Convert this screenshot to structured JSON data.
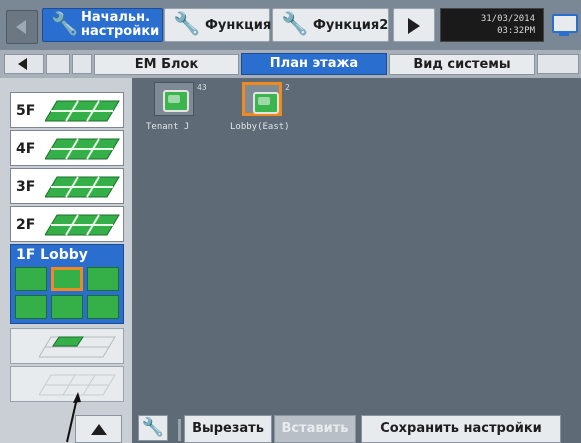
{
  "toolbar": {
    "active_tab_label": "Начальн.\nнастройки",
    "function1_label": "Функция1",
    "function2_label": "Функция2",
    "date": "31/03/2014",
    "time": "03:32PM"
  },
  "tabs": [
    {
      "label": "ЕМ Блок"
    },
    {
      "label": "План этажа",
      "selected": true
    },
    {
      "label": "Вид системы"
    }
  ],
  "floors": [
    {
      "label": "5F"
    },
    {
      "label": "4F"
    },
    {
      "label": "3F"
    },
    {
      "label": "2F"
    },
    {
      "label": "1F Lobby",
      "active": true
    }
  ],
  "units": [
    {
      "number": "43",
      "label": "Tenant J",
      "selected": false
    },
    {
      "number": "2",
      "label": "Lobby(East)",
      "selected": true
    }
  ],
  "bottom": {
    "cut_label": "Вырезать",
    "paste_label": "Вставить",
    "save_label": "Сохранить настройки"
  },
  "colors": {
    "accent": "#2a6fcf",
    "floor_green": "#35b048",
    "selection_orange": "#f08a1c",
    "workspace": "#5e6a76"
  }
}
